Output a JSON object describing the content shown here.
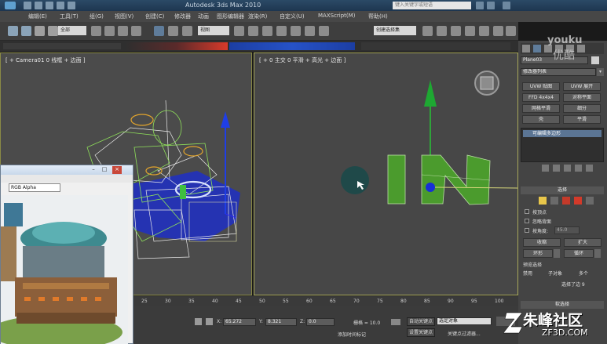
{
  "app": {
    "title": "Autodesk 3ds Max 2010",
    "search_placeholder": "键入关键字或短语"
  },
  "menu": [
    "编辑(E)",
    "工具(T)",
    "组(G)",
    "视图(V)",
    "创建(C)",
    "修改器",
    "动画",
    "图形编辑器",
    "渲染(R)",
    "自定义(U)",
    "MAXScript(M)",
    "帮助(H)"
  ],
  "toolbar": {
    "filter": "全部",
    "ref_coord": "视图",
    "selection_set": "创建选择集"
  },
  "viewports": {
    "left_label": "[ + Camera01 0 线框 + 边面 ]",
    "right_label": "[ + 0 主交 0 平滑 + 高光 + 边面 ]"
  },
  "command_panel": {
    "object_name": "Plane03",
    "modifier_list": "修改器列表",
    "modifier_buttons": [
      "UVW 贴图",
      "UVW 展开",
      "FFD 4x4x4",
      "对称平面",
      "网格平滑",
      "细分",
      "壳",
      "平滑"
    ],
    "stack_item": "可编辑多边形",
    "rollout_selection": "选择",
    "options": [
      "按顶点",
      "忽略背面",
      "按角度:"
    ],
    "angle_value": "45.0",
    "shrink": "收缩",
    "grow": "扩大",
    "ring": "环形",
    "loop": "循环",
    "preview_selection": "预览选择",
    "preview_options": [
      "禁用",
      "子对象",
      "多个"
    ],
    "selected_status": "选择了边 9",
    "soft_selection": "软选择",
    "accent_color": "#e8c64a"
  },
  "timeline": {
    "ticks": [
      "25",
      "30",
      "35",
      "40",
      "45",
      "50",
      "55",
      "60",
      "65",
      "70",
      "75",
      "80",
      "85",
      "90",
      "95",
      "100"
    ]
  },
  "status": {
    "x_label": "X:",
    "x": "65.272",
    "y_label": "Y:",
    "y": "8.321",
    "z_label": "Z:",
    "z": "0.0",
    "grid": "栅格 = 10.0",
    "auto_key": "自动关键点",
    "selected_dropdown": "选定对象",
    "set_key": "设置关键点",
    "key_filters": "关键点过滤器...",
    "add_time_tag": "添加时间标记"
  },
  "render_window": {
    "channel": "RGB Alpha"
  },
  "watermark": {
    "youku": "youku",
    "youku_cn": "优酷",
    "brand": "朱峰社区",
    "url": "ZF3D.COM"
  }
}
